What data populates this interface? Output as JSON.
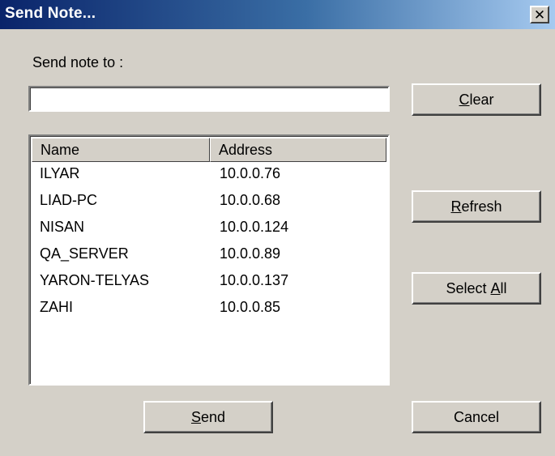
{
  "window": {
    "title": "Send Note...",
    "close_glyph": "✕"
  },
  "send_to": {
    "label": "Send note to :",
    "value": ""
  },
  "buttons": {
    "clear": {
      "mnemonic": "C",
      "rest": "lear"
    },
    "refresh": {
      "mnemonic": "R",
      "rest": "efresh"
    },
    "select_all": {
      "before": "Select ",
      "mnemonic": "A",
      "rest": "ll"
    },
    "send": {
      "mnemonic": "S",
      "rest": "end"
    },
    "cancel": {
      "label": "Cancel"
    }
  },
  "list": {
    "columns": [
      "Name",
      "Address"
    ],
    "rows": [
      {
        "name": "ILYAR",
        "address": "10.0.0.76"
      },
      {
        "name": "LIAD-PC",
        "address": "10.0.0.68"
      },
      {
        "name": "NISAN",
        "address": "10.0.0.124"
      },
      {
        "name": "QA_SERVER",
        "address": "10.0.0.89"
      },
      {
        "name": "YARON-TELYAS",
        "address": "10.0.0.137"
      },
      {
        "name": "ZAHI",
        "address": "10.0.0.85"
      }
    ]
  },
  "colors": {
    "titlebar_start": "#0a246a",
    "titlebar_end": "#a6caf0",
    "dialog_face": "#d4d0c8"
  },
  "icons": {
    "close": "close-icon"
  }
}
